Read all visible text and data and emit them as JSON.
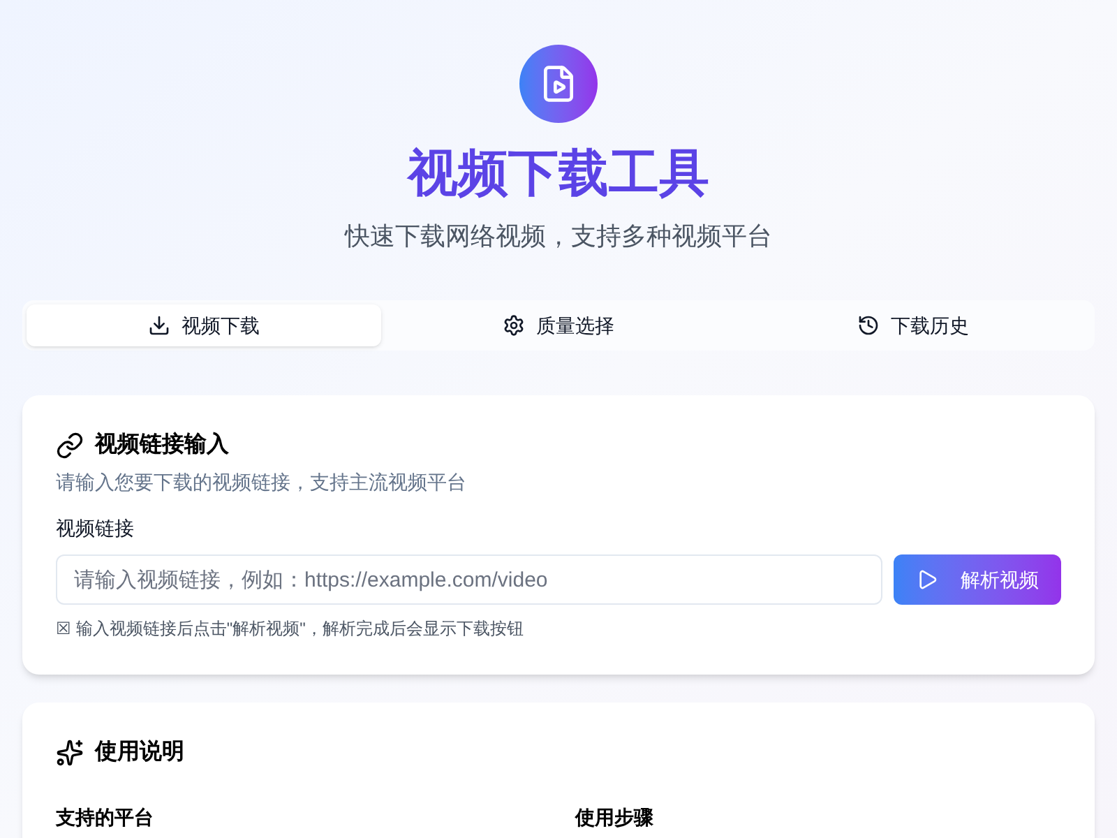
{
  "header": {
    "title": "视频下载工具",
    "subtitle": "快速下载网络视频，支持多种视频平台"
  },
  "tabs": [
    {
      "label": "视频下载",
      "selected": true
    },
    {
      "label": "质量选择",
      "selected": false
    },
    {
      "label": "下载历史",
      "selected": false
    }
  ],
  "link_card": {
    "title": "视频链接输入",
    "description": "请输入您要下载的视频链接，支持主流视频平台",
    "field_label": "视频链接",
    "placeholder": "请输入视频链接，例如：https://example.com/video",
    "button": "解析视频",
    "hint": "☒ 输入视频链接后点击\"解析视频\"，解析完成后会显示下载按钮"
  },
  "help_card": {
    "title": "使用说明",
    "columns": [
      "支持的平台",
      "使用步骤"
    ]
  }
}
